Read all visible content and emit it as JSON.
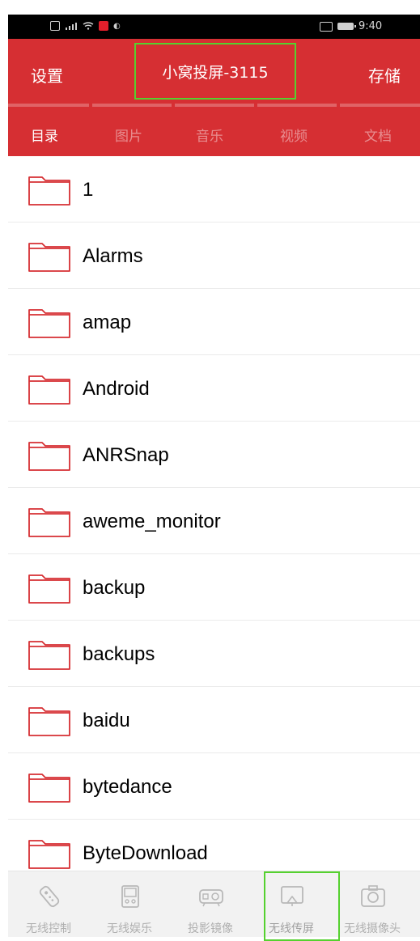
{
  "status_bar": {
    "time": "9:40",
    "icons": [
      "sim-icon",
      "signal-icon",
      "wifi-icon",
      "notification-badge-icon",
      "app-icon",
      "nfc-icon",
      "battery-icon"
    ]
  },
  "header": {
    "left_label": "设置",
    "title": "小窝投屏-3115",
    "right_label": "存储"
  },
  "tabs": [
    {
      "label": "目录",
      "active": true
    },
    {
      "label": "图片",
      "active": false
    },
    {
      "label": "音乐",
      "active": false
    },
    {
      "label": "视频",
      "active": false
    },
    {
      "label": "文档",
      "active": false
    }
  ],
  "folders": [
    {
      "name": "1"
    },
    {
      "name": "Alarms"
    },
    {
      "name": "amap"
    },
    {
      "name": "Android"
    },
    {
      "name": "ANRSnap"
    },
    {
      "name": "aweme_monitor"
    },
    {
      "name": "backup"
    },
    {
      "name": "backups"
    },
    {
      "name": "baidu"
    },
    {
      "name": "bytedance"
    },
    {
      "name": "ByteDownload"
    }
  ],
  "bottom_nav": [
    {
      "label": "无线控制",
      "icon": "remote-control-icon"
    },
    {
      "label": "无线娱乐",
      "icon": "gamepad-icon"
    },
    {
      "label": "投影镜像",
      "icon": "projector-icon"
    },
    {
      "label": "无线传屏",
      "icon": "screen-cast-icon",
      "selected": true
    },
    {
      "label": "无线摄像头",
      "icon": "camera-icon"
    }
  ],
  "colors": {
    "accent": "#d62f33",
    "highlight": "#55d12f"
  }
}
